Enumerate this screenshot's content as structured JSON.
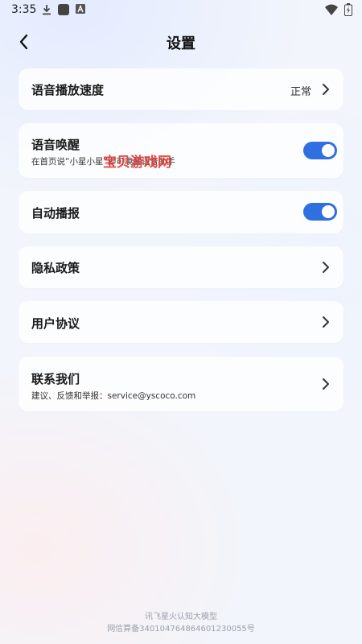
{
  "status_bar": {
    "time": "3:35",
    "icons": [
      "download-icon",
      "app-square-icon",
      "app-a-icon",
      "wifi-icon",
      "battery-icon"
    ]
  },
  "header": {
    "title": "设置"
  },
  "settings": {
    "speech_speed": {
      "label": "语音播放速度",
      "value": "正常"
    },
    "voice_wake": {
      "label": "语音唤醒",
      "description": "在首页说“小星小星”即可唤醒语音助手",
      "enabled": true
    },
    "auto_play": {
      "label": "自动播报",
      "enabled": true
    },
    "privacy": {
      "label": "隐私政策"
    },
    "user_agreement": {
      "label": "用户协议"
    },
    "contact": {
      "label": "联系我们",
      "description": "建议、反馈和举报：service@yscoco.com"
    }
  },
  "watermark": "宝贝游戏网",
  "footer": {
    "line1": "讯飞星火认知大模型",
    "line2": "网信算备340104764864601230055号"
  },
  "colors": {
    "accent": "#2f6fe0",
    "watermark": "#e53935"
  }
}
